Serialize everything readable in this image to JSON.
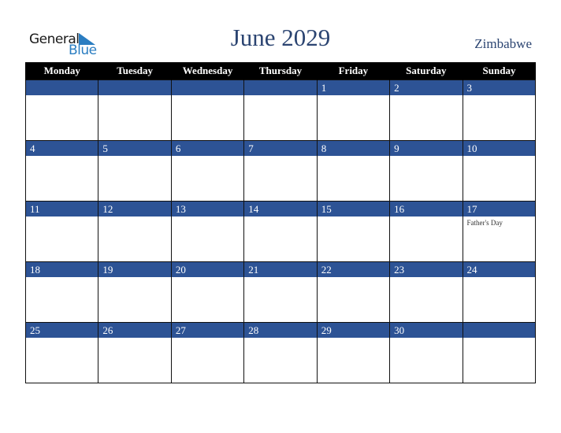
{
  "logo": {
    "line1": "General",
    "line2": "Blue"
  },
  "title": "June 2029",
  "country": "Zimbabwe",
  "colors": {
    "header_bg": "#000000",
    "band": "#2d5395",
    "title": "#2b4471",
    "logo_blue": "#2a7dc1"
  },
  "weekdays": [
    "Monday",
    "Tuesday",
    "Wednesday",
    "Thursday",
    "Friday",
    "Saturday",
    "Sunday"
  ],
  "weeks": [
    [
      {
        "d": ""
      },
      {
        "d": ""
      },
      {
        "d": ""
      },
      {
        "d": ""
      },
      {
        "d": "1"
      },
      {
        "d": "2"
      },
      {
        "d": "3"
      }
    ],
    [
      {
        "d": "4"
      },
      {
        "d": "5"
      },
      {
        "d": "6"
      },
      {
        "d": "7"
      },
      {
        "d": "8"
      },
      {
        "d": "9"
      },
      {
        "d": "10"
      }
    ],
    [
      {
        "d": "11"
      },
      {
        "d": "12"
      },
      {
        "d": "13"
      },
      {
        "d": "14"
      },
      {
        "d": "15"
      },
      {
        "d": "16"
      },
      {
        "d": "17",
        "event": "Father's Day"
      }
    ],
    [
      {
        "d": "18"
      },
      {
        "d": "19"
      },
      {
        "d": "20"
      },
      {
        "d": "21"
      },
      {
        "d": "22"
      },
      {
        "d": "23"
      },
      {
        "d": "24"
      }
    ],
    [
      {
        "d": "25"
      },
      {
        "d": "26"
      },
      {
        "d": "27"
      },
      {
        "d": "28"
      },
      {
        "d": "29"
      },
      {
        "d": "30"
      },
      {
        "d": ""
      }
    ]
  ]
}
